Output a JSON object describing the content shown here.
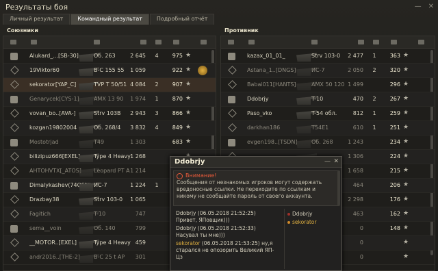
{
  "window": {
    "title": "Результаты боя"
  },
  "tabs": [
    {
      "label": "Личный результат"
    },
    {
      "label": "Командный результат"
    },
    {
      "label": "Подробный отчёт"
    }
  ],
  "allies": {
    "header": "Союзники",
    "rows": [
      {
        "player": "Alukard_...[SB-30]",
        "vehicle": "Об. 263",
        "damage": "2 645",
        "kills": "4",
        "xp": "975",
        "style": "alive"
      },
      {
        "player": "19Viktor60",
        "vehicle": "В-С 155 55",
        "damage": "1 059",
        "kills": "",
        "xp": "922",
        "style": "alive",
        "medal": true
      },
      {
        "player": "sekorator[YAP_C]",
        "vehicle": "TVP T 50/51",
        "damage": "4 084",
        "kills": "2",
        "xp": "907",
        "style": "me"
      },
      {
        "player": "Genarycek[CYS-1]",
        "vehicle": "AMX 13 90",
        "damage": "1 974",
        "kills": "1",
        "xp": "870",
        "style": "dead"
      },
      {
        "player": "vovan_bo..[AVA-]",
        "vehicle": "Strv 103B",
        "damage": "2 943",
        "kills": "3",
        "xp": "866",
        "style": "alive"
      },
      {
        "player": "kozgan19802004",
        "vehicle": "Об. 268/4",
        "damage": "3 832",
        "kills": "4",
        "xp": "849",
        "style": "alive"
      },
      {
        "player": "Mostotrjad",
        "vehicle": "T49",
        "damage": "1 303",
        "kills": "",
        "xp": "683",
        "style": "dead"
      },
      {
        "player": "bilizipuz666[EXEL]",
        "vehicle": "Type 4 Heavy",
        "damage": "1 268",
        "kills": "",
        "xp": "",
        "style": "alive"
      },
      {
        "player": "АНТОНVTX[_ATOS]",
        "vehicle": "Leopard PT A",
        "damage": "1 214",
        "kills": "",
        "xp": "",
        "style": "dead"
      },
      {
        "player": "Dimalykashev(74OSN)",
        "vehicle": "ИС-7",
        "damage": "1 224",
        "kills": "1",
        "xp": "",
        "style": "alive"
      },
      {
        "player": "Drazbay38",
        "vehicle": "Strv 103-0",
        "damage": "1 065",
        "kills": "",
        "xp": "",
        "style": "alive"
      },
      {
        "player": "Fagitich",
        "vehicle": "T-10",
        "damage": "747",
        "kills": "",
        "xp": "",
        "style": "dead"
      },
      {
        "player": "sema__voin",
        "vehicle": "Об. 140",
        "damage": "799",
        "kills": "",
        "xp": "",
        "style": "dead"
      },
      {
        "player": "__MOTOR..[EXEL]",
        "vehicle": "Type 4 Heavy",
        "damage": "459",
        "kills": "",
        "xp": "",
        "style": "alive"
      },
      {
        "player": "andr2016..[THE-2]",
        "vehicle": "В-С 25 t AP",
        "damage": "301",
        "kills": "",
        "xp": "",
        "style": "dead"
      }
    ]
  },
  "enemies": {
    "header": "Противник",
    "rows": [
      {
        "player": "kazax_01_01_",
        "vehicle": "Strv 103-0",
        "damage": "2 477",
        "kills": "1",
        "xp": "363",
        "style": "alive"
      },
      {
        "player": "Astana_1..[DNGS]",
        "vehicle": "ИС-7",
        "damage": "2 050",
        "kills": "2",
        "xp": "320",
        "style": "dead"
      },
      {
        "player": "Babai011[HANTS]",
        "vehicle": "AMX 50 120",
        "damage": "1 499",
        "kills": "",
        "xp": "296",
        "style": "dead"
      },
      {
        "player": "Ddobrjy",
        "vehicle": "T-10",
        "damage": "470",
        "kills": "2",
        "xp": "267",
        "style": "alive"
      },
      {
        "player": "Paso_vko",
        "vehicle": "T-54 обл.",
        "damage": "812",
        "kills": "1",
        "xp": "259",
        "style": "alive"
      },
      {
        "player": "darkhan186",
        "vehicle": "T54E1",
        "damage": "610",
        "kills": "1",
        "xp": "251",
        "style": "dead"
      },
      {
        "player": "evgen198..[TSDN]",
        "vehicle": "Об. 268",
        "damage": "1 243",
        "kills": "",
        "xp": "234",
        "style": "dead"
      },
      {
        "player": "",
        "vehicle": "",
        "damage": "1 306",
        "kills": "",
        "xp": "224",
        "style": "dead"
      },
      {
        "player": "",
        "vehicle": "",
        "damage": "1 658",
        "kills": "",
        "xp": "215",
        "style": "dead"
      },
      {
        "player": "",
        "vehicle": "",
        "damage": "464",
        "kills": "",
        "xp": "206",
        "style": "dead"
      },
      {
        "player": "",
        "vehicle": "",
        "damage": "2 298",
        "kills": "",
        "xp": "176",
        "style": "dead"
      },
      {
        "player": "",
        "vehicle": "",
        "damage": "463",
        "kills": "",
        "xp": "162",
        "style": "dead"
      },
      {
        "player": "",
        "vehicle": "",
        "damage": "0",
        "kills": "",
        "xp": "148",
        "style": "dead"
      },
      {
        "player": "",
        "vehicle": "",
        "damage": "0",
        "kills": "",
        "xp": "",
        "style": "dead"
      },
      {
        "player": "",
        "vehicle": "",
        "damage": "0",
        "kills": "",
        "xp": "",
        "style": "dead"
      }
    ]
  },
  "chat": {
    "title": "Ddobrjy",
    "warning_title": "Внимание!",
    "warning_text": "Сообщения от незнакомых игроков могут содержать вредоносные ссылки. Не переходите по ссылкам и никому не сообщайте пароль от своего аккаунта.",
    "messages": [
      {
        "author": "Ddobrjy",
        "time": "(06.05.2018 21:52:25)",
        "text": "Привет, ЯПовщик)))"
      },
      {
        "author": "Ddobrjy",
        "time": "(06.05.2018 21:52:33)",
        "text": "Насувал ты мне)))"
      },
      {
        "author": "sekorator",
        "time": "(06.05.2018 21:53:25)",
        "text": "ну,я старался не опозорить Великий ЯП-Цз"
      }
    ],
    "participants": [
      "Ddobrjy",
      "sekorator"
    ]
  }
}
